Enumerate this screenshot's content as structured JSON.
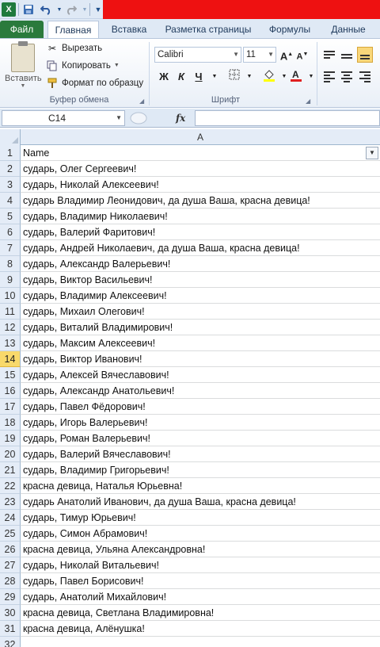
{
  "quick_access": {
    "app_icon": "X",
    "undo_icon": "undo-icon",
    "redo_icon": "redo-icon",
    "save_icon": "save-icon"
  },
  "tabs": [
    {
      "label": "Файл"
    },
    {
      "label": "Главная"
    },
    {
      "label": "Вставка"
    },
    {
      "label": "Разметка страницы"
    },
    {
      "label": "Формулы"
    },
    {
      "label": "Данные"
    }
  ],
  "clipboard": {
    "paste_label": "Вставить",
    "cut_label": "Вырезать",
    "copy_label": "Копировать",
    "format_painter_label": "Формат по образцу",
    "group_label": "Буфер обмена"
  },
  "font": {
    "name": "Calibri",
    "size": "11",
    "group_label": "Шрифт",
    "bold": "Ж",
    "italic": "К",
    "underline": "Ч"
  },
  "formula_bar": {
    "name_box": "C14",
    "fx": "fx",
    "value": ""
  },
  "sheet": {
    "column": "A",
    "selected_row": 14,
    "rows": [
      {
        "num": "1",
        "text": "Name"
      },
      {
        "num": "2",
        "text": "сударь, Олег Сергеевич!"
      },
      {
        "num": "3",
        "text": "сударь, Николай Алексеевич!"
      },
      {
        "num": "4",
        "text": "сударь Владимир Леонидович, да душа Ваша, красна девица!"
      },
      {
        "num": "5",
        "text": "сударь, Владимир Николаевич!"
      },
      {
        "num": "6",
        "text": "сударь, Валерий Фаритович!"
      },
      {
        "num": "7",
        "text": "сударь, Андрей Николаевич, да душа Ваша, красна девица!"
      },
      {
        "num": "8",
        "text": "сударь, Александр Валерьевич!"
      },
      {
        "num": "9",
        "text": "сударь, Виктор Васильевич!"
      },
      {
        "num": "10",
        "text": "сударь, Владимир Алексеевич!"
      },
      {
        "num": "11",
        "text": "сударь, Михаил Олегович!"
      },
      {
        "num": "12",
        "text": "сударь, Виталий Владимирович!"
      },
      {
        "num": "13",
        "text": "сударь, Максим Алексеевич!"
      },
      {
        "num": "14",
        "text": "сударь, Виктор Иванович!"
      },
      {
        "num": "15",
        "text": "сударь, Алексей Вячеславович!"
      },
      {
        "num": "16",
        "text": "сударь, Александр Анатольевич!"
      },
      {
        "num": "17",
        "text": "сударь, Павел Фёдорович!"
      },
      {
        "num": "18",
        "text": "сударь, Игорь Валерьевич!"
      },
      {
        "num": "19",
        "text": "сударь, Роман Валерьевич!"
      },
      {
        "num": "20",
        "text": "сударь, Валерий Вячеславович!"
      },
      {
        "num": "21",
        "text": "сударь, Владимир Григорьевич!"
      },
      {
        "num": "22",
        "text": "красна девица, Наталья Юрьевна!"
      },
      {
        "num": "23",
        "text": "сударь Анатолий Иванович, да душа Ваша, красна девица!"
      },
      {
        "num": "24",
        "text": "сударь, Тимур Юрьевич!"
      },
      {
        "num": "25",
        "text": "сударь, Симон Абрамович!"
      },
      {
        "num": "26",
        "text": "красна девица, Ульяна Александровна!"
      },
      {
        "num": "27",
        "text": "сударь, Николай Витальевич!"
      },
      {
        "num": "28",
        "text": "сударь, Павел Борисович!"
      },
      {
        "num": "29",
        "text": "сударь, Анатолий Михайлович!"
      },
      {
        "num": "30",
        "text": "красна девица, Светлана Владимировна!"
      },
      {
        "num": "31",
        "text": "красна девица, Алёнушка!"
      },
      {
        "num": "32",
        "text": ""
      }
    ]
  }
}
